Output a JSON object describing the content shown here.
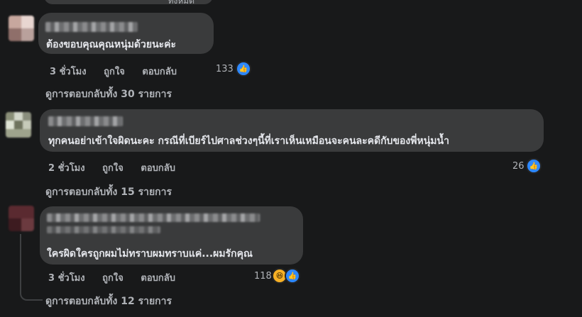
{
  "top_fragment": "ทั้งหมด",
  "comments": [
    {
      "text": "ต้องขอบคุณคุณหนุ่มด้วยนะค่ะ",
      "time": "3 ชั่วโมง",
      "like_label": "ถูกใจ",
      "reply_label": "ตอบกลับ",
      "reaction_count": "133",
      "reactions": [
        "like-icon"
      ],
      "view_replies": "ดูการตอบกลับทั้ง 30 รายการ"
    },
    {
      "text": "ทุกคนอย่าเข้าใจผิดนะคะ กรณีที่เบียร์ไปศาลช่วงๆนี้ที่เราเห็นเหมือนจะคนละคดีกับของพี่หนุ่มน้ำ",
      "time": "2 ชั่วโมง",
      "like_label": "ถูกใจ",
      "reply_label": "ตอบกลับ",
      "reaction_count": "26",
      "reactions": [
        "like-icon"
      ],
      "view_replies": "ดูการตอบกลับทั้ง 15 รายการ"
    },
    {
      "text": "ใครผิดใครถูกผมไม่ทราบผมทราบแค่...ผมรักคุณ",
      "time": "3 ชั่วโมง",
      "like_label": "ถูกใจ",
      "reply_label": "ตอบกลับ",
      "reaction_count": "118",
      "reactions": [
        "haha-icon",
        "like-icon"
      ],
      "view_replies": "ดูการตอบกลับทั้ง 12 รายการ"
    }
  ],
  "colors": {
    "background": "#18191a",
    "bubble": "#3a3b3c",
    "text": "#e4e6eb",
    "secondary_text": "#b0b3b8",
    "like_blue": "#2d88ff",
    "haha_yellow": "#f7b125"
  }
}
